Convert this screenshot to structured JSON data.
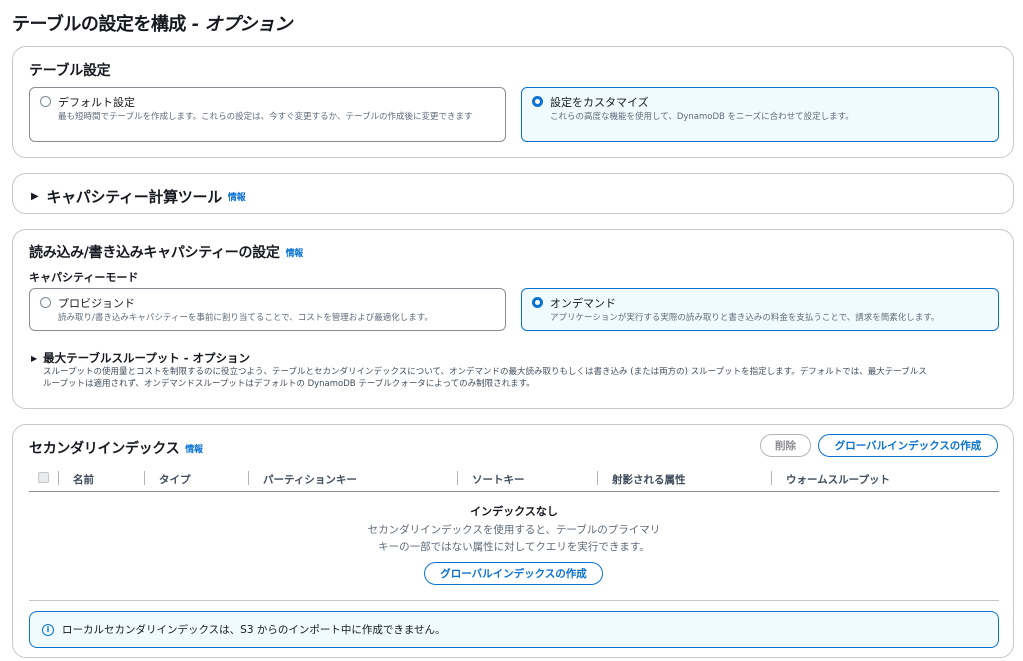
{
  "page": {
    "title_main": "テーブルの設定を構成",
    "title_sep": " - ",
    "title_opt": "オプション"
  },
  "table_settings": {
    "heading": "テーブル設定",
    "options": [
      {
        "label": "デフォルト設定",
        "desc": "最も短時間でテーブルを作成します。これらの設定は、今すぐ変更するか、テーブルの作成後に変更できます",
        "selected": false
      },
      {
        "label": "設定をカスタマイズ",
        "desc": "これらの高度な機能を使用して、DynamoDB をニーズに合わせて設定します。",
        "selected": true
      }
    ]
  },
  "capacity_calculator": {
    "heading": "キャパシティー計算ツール",
    "info": "情報"
  },
  "rw_capacity": {
    "heading": "読み込み/書き込みキャパシティーの設定",
    "info": "情報",
    "mode_label": "キャパシティーモード",
    "options": [
      {
        "label": "プロビジョンド",
        "desc": "読み取り/書き込みキャパシティーを事前に割り当てることで、コストを管理および最適化します。",
        "selected": false
      },
      {
        "label": "オンデマンド",
        "desc": "アプリケーションが実行する実際の読み取りと書き込みの料金を支払うことで、請求を簡素化します。",
        "selected": true
      }
    ],
    "max_throughput": {
      "heading": "最大テーブルスループット - オプション",
      "desc_line1": "スループットの使用量とコストを制限するのに役立つよう、テーブルとセカンダリインデックスについて、オンデマンドの最大読み取りもしくは書き込み (または両方の) スループットを指定します。デフォルトでは、最大テーブルス",
      "desc_line2": "ループットは適用されず、オンデマンドスループットはデフォルトの DynamoDB テーブルクォータによってのみ制限されます。"
    }
  },
  "secondary_indexes": {
    "heading": "セカンダリインデックス",
    "info": "情報",
    "delete_label": "削除",
    "create_global_label": "グローバルインデックスの作成",
    "columns": [
      "名前",
      "タイプ",
      "パーティションキー",
      "ソートキー",
      "射影される属性",
      "ウォームスループット"
    ],
    "empty_title": "インデックスなし",
    "empty_line1": "セカンダリインデックスを使用すると、テーブルのプライマリ",
    "empty_line2": "キーの一部ではない属性に対してクエリを実行できます。",
    "empty_button": "グローバルインデックスの作成",
    "alert": "ローカルセカンダリインデックスは、S3 からのインポート中に作成できません。"
  },
  "colors": {
    "accent": "#0972d3",
    "selected_bg": "#f0fbff",
    "border": "#c6c6cd"
  }
}
